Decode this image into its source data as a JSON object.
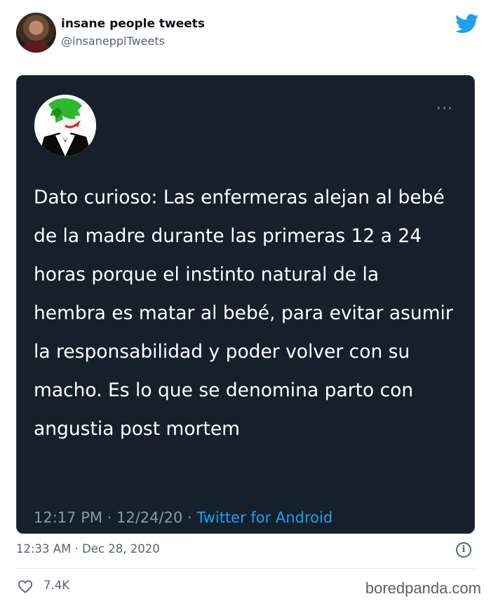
{
  "author": {
    "name": "insane people tweets",
    "handle": "@insanepplTweets"
  },
  "embedded_tweet": {
    "more_label": "···",
    "text": "Dato curioso: Las enfermeras alejan al bebé de la madre durante las primeras 12 a 24 horas porque el instinto natural de la hembra es matar al bebé, para evitar asumir la responsabilidad y poder volver con su macho. Es lo que se denomina parto con angustia post mortem",
    "time_date": "12:17 PM · 12/24/20 · ",
    "source": "Twitter for Android"
  },
  "tweet": {
    "timestamp": "12:33 AM · Dec 28, 2020",
    "info_label": "i",
    "likes": "7.4K"
  },
  "watermark": "boredpanda.com",
  "colors": {
    "twitter_blue": "#1da1f2",
    "card_bg": "#15202b",
    "muted": "#536471"
  },
  "icons": [
    "twitter-bird-icon",
    "more-icon",
    "info-icon",
    "heart-icon"
  ]
}
